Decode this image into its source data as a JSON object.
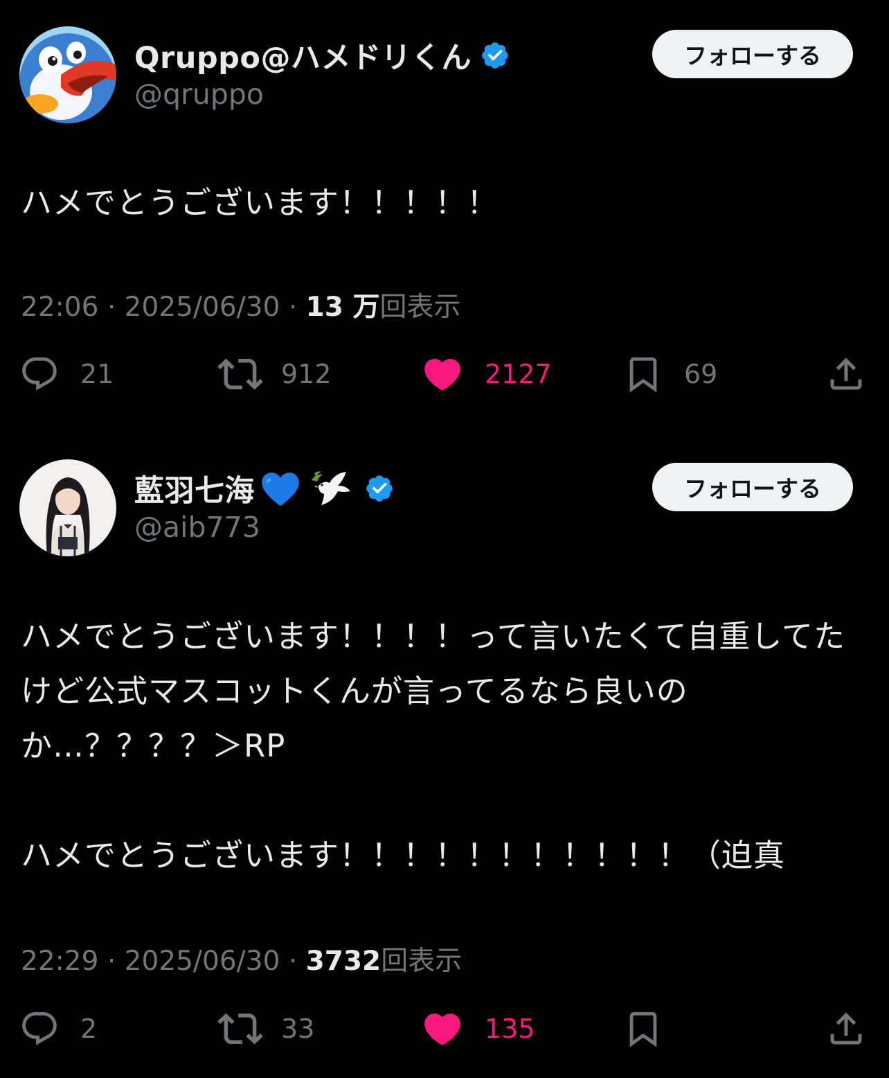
{
  "colors": {
    "background": "#000000",
    "text_primary": "#e7e9ea",
    "text_secondary": "#71767b",
    "like_pink": "#f91880",
    "verified_blue": "#1d9bf0",
    "follow_button_bg": "#eff3f4"
  },
  "tweets": [
    {
      "author": {
        "display_name": "Qruppo@ハメドリくん",
        "name_emoji": "",
        "handle": "@qruppo",
        "verified": true,
        "avatar_icon": "bird-mascot-avatar"
      },
      "follow_label": "フォローする",
      "text": "ハメでとうございます！！！！！",
      "time": "22:06",
      "date": "2025/06/30",
      "views_count": "13 万",
      "views_label": "回表示",
      "separator": "·",
      "stats": {
        "replies": "21",
        "reposts": "912",
        "likes": "2127",
        "bookmarks": "69"
      },
      "liked": true
    },
    {
      "author": {
        "display_name": "藍羽七海",
        "name_emoji": "💙🕊️",
        "handle": "@aib773",
        "verified": true,
        "avatar_icon": "person-photo-avatar"
      },
      "follow_label": "フォローする",
      "text": "ハメでとうございます！！！！って言いたくて自重してたけど公式マスコットくんが言ってるなら良いのか…？？？？＞RP\n\nハメでとうございます！！！！！！！！！！！（迫真",
      "time": "22:29",
      "date": "2025/06/30",
      "views_count": "3732",
      "views_label": "回表示",
      "separator": "·",
      "stats": {
        "replies": "2",
        "reposts": "33",
        "likes": "135",
        "bookmarks": ""
      },
      "liked": true
    }
  ]
}
